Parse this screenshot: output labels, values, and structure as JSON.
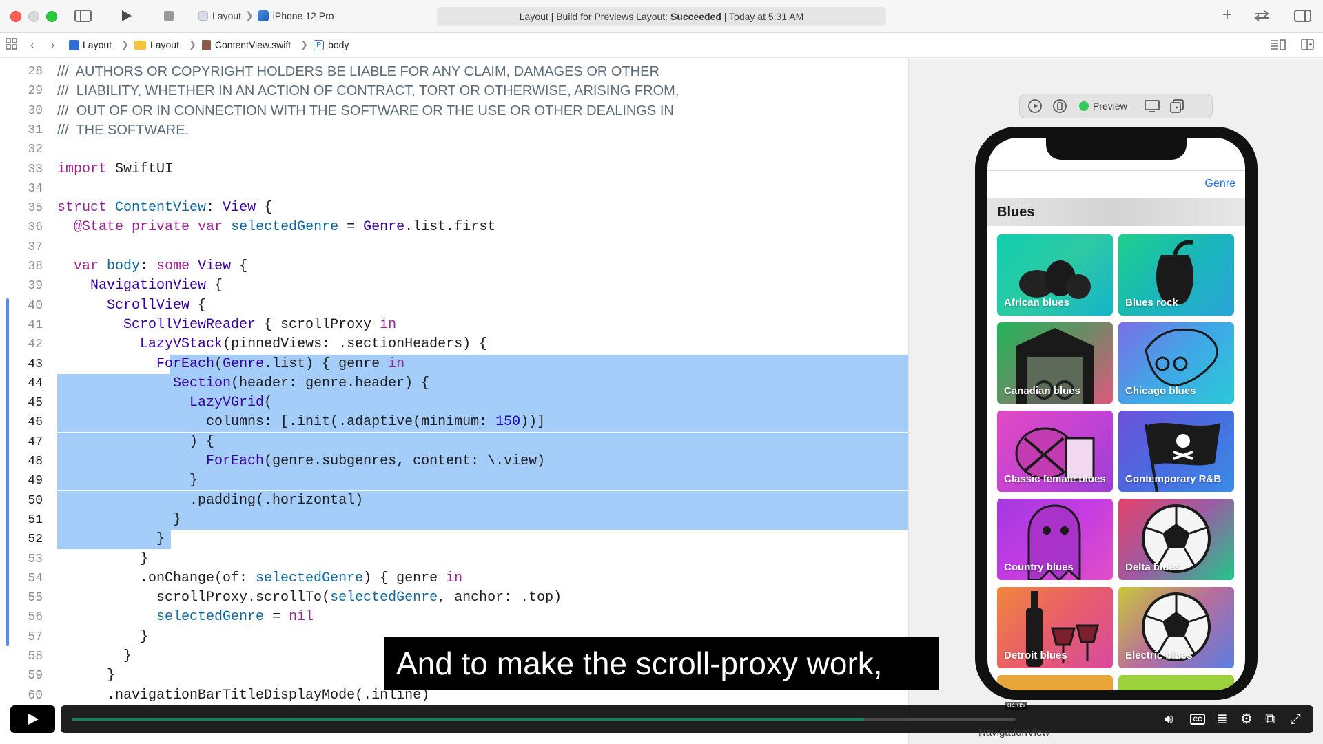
{
  "window": {
    "scheme": "Layout",
    "device": "iPhone 12 Pro",
    "activity_prefix": "Layout | Build for Previews Layout:",
    "activity_status": "Succeeded",
    "activity_suffix": "| Today at 5:31 AM"
  },
  "breadcrumb": [
    "Layout",
    "Layout",
    "ContentView.swift",
    "body"
  ],
  "editor": {
    "lines": [
      {
        "n": "28",
        "text": "///  AUTHORS OR COPYRIGHT HOLDERS BE LIABLE FOR ANY CLAIM, DAMAGES OR OTHER"
      },
      {
        "n": "29",
        "text": "///  LIABILITY, WHETHER IN AN ACTION OF CONTRACT, TORT OR OTHERWISE, ARISING FROM,"
      },
      {
        "n": "30",
        "text": "///  OUT OF OR IN CONNECTION WITH THE SOFTWARE OR THE USE OR OTHER DEALINGS IN"
      },
      {
        "n": "31",
        "text": "///  THE SOFTWARE."
      },
      {
        "n": "32",
        "text": ""
      },
      {
        "n": "33",
        "text": "import SwiftUI"
      },
      {
        "n": "34",
        "text": ""
      },
      {
        "n": "35",
        "text": "struct ContentView: View {"
      },
      {
        "n": "36",
        "text": "  @State private var selectedGenre = Genre.list.first"
      },
      {
        "n": "37",
        "text": ""
      },
      {
        "n": "38",
        "text": "  var body: some View {"
      },
      {
        "n": "39",
        "text": "    NavigationView {"
      },
      {
        "n": "40",
        "text": "      ScrollView {"
      },
      {
        "n": "41",
        "text": "        ScrollViewReader { scrollProxy in"
      },
      {
        "n": "42",
        "text": "          LazyVStack(pinnedViews: .sectionHeaders) {"
      },
      {
        "n": "43",
        "text": "            ForEach(Genre.list) { genre in"
      },
      {
        "n": "44",
        "text": "              Section(header: genre.header) {"
      },
      {
        "n": "45",
        "text": "                LazyVGrid("
      },
      {
        "n": "46",
        "text": "                  columns: [.init(.adaptive(minimum: 150))]"
      },
      {
        "n": "47",
        "text": "                ) {"
      },
      {
        "n": "48",
        "text": "                  ForEach(genre.subgenres, content: \\.view)"
      },
      {
        "n": "49",
        "text": "                }"
      },
      {
        "n": "50",
        "text": "                .padding(.horizontal)"
      },
      {
        "n": "51",
        "text": "              }"
      },
      {
        "n": "52",
        "text": "            }"
      },
      {
        "n": "53",
        "text": "          }"
      },
      {
        "n": "54",
        "text": "          .onChange(of: selectedGenre) { genre in"
      },
      {
        "n": "55",
        "text": "            scrollProxy.scrollTo(selectedGenre, anchor: .top)"
      },
      {
        "n": "56",
        "text": "            selectedGenre = nil"
      },
      {
        "n": "57",
        "text": "          }"
      },
      {
        "n": "58",
        "text": "        }"
      },
      {
        "n": "59",
        "text": "      }"
      },
      {
        "n": "60",
        "text": "      .navigationBarTitleDisplayMode(.inline)"
      }
    ]
  },
  "preview": {
    "live_label": "Preview",
    "nav_button": "Genre",
    "section_title": "Blues",
    "tiles": [
      {
        "label": "African blues",
        "colors": [
          "#0fcfae",
          "#2ec9a4",
          "#14b5c9"
        ],
        "icon": "pears-icon"
      },
      {
        "label": "Blues rock",
        "colors": [
          "#1ecf8c",
          "#19b7b9",
          "#2aa4d8"
        ],
        "icon": "apple-core-icon"
      },
      {
        "label": "Canadian blues",
        "colors": [
          "#22b55a",
          "#6d8a64",
          "#e0577e"
        ],
        "icon": "shed-icon"
      },
      {
        "label": "Chicago blues",
        "colors": [
          "#7b6ee6",
          "#40a7e6",
          "#2ac9d6"
        ],
        "icon": "owl-icon"
      },
      {
        "label": "Classic female blues",
        "colors": [
          "#e24ac2",
          "#c443d3",
          "#9b3ed6"
        ],
        "icon": "crab-icon"
      },
      {
        "label": "Contemporary R&B",
        "colors": [
          "#6c51d9",
          "#4a6be0",
          "#3a8ce6"
        ],
        "icon": "flag-icon"
      },
      {
        "label": "Country blues",
        "colors": [
          "#a33ae0",
          "#c43ce2",
          "#e24fc6"
        ],
        "icon": "ghost-icon"
      },
      {
        "label": "Delta blues",
        "colors": [
          "#e2426a",
          "#9a5da4",
          "#1fc78a"
        ],
        "icon": "soccer-ball-icon"
      },
      {
        "label": "Detroit blues",
        "colors": [
          "#f0883d",
          "#e85d6a",
          "#d84aa0"
        ],
        "icon": "wine-icon"
      },
      {
        "label": "Electric blues",
        "colors": [
          "#c8c839",
          "#b86d9c",
          "#5b7de2"
        ],
        "icon": "soccer-ball-icon"
      }
    ]
  },
  "video": {
    "caption": "And to make the scroll-proxy work,",
    "time": "04:05",
    "progress": 0.84
  },
  "statusbar": {
    "label": "NavigationView"
  }
}
